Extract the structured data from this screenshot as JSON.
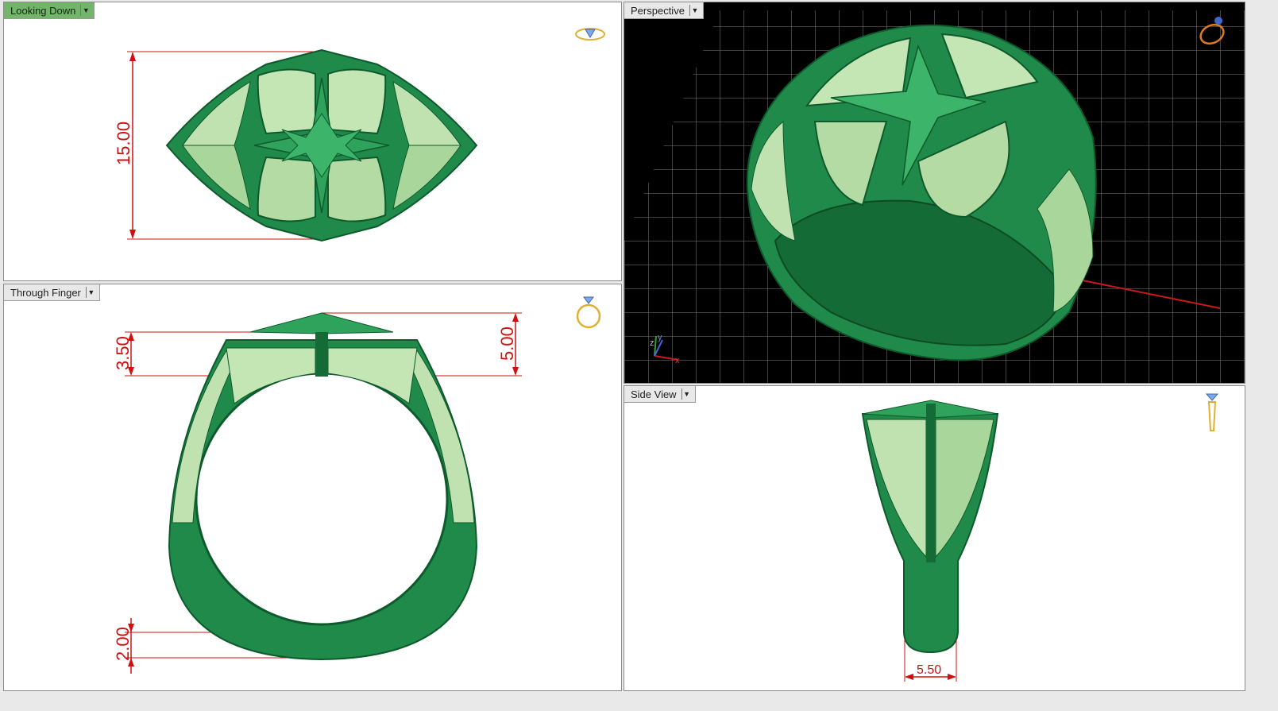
{
  "viewports": {
    "top": {
      "label": "Looking Down",
      "dimension": "15.00"
    },
    "front": {
      "label": "Through Finger",
      "dimension_left": "3.50",
      "dimension_right": "5.00",
      "dimension_bottom": "2.00"
    },
    "perspective": {
      "label": "Perspective",
      "axis_y": "y",
      "axis_z": "z",
      "axis_x": "x"
    },
    "side": {
      "label": "Side View",
      "dimension": "5.50"
    }
  },
  "colors": {
    "ring_green": "#1f8a4a",
    "ring_dark": "#0d5a2c",
    "filigree": "#bfe2b0",
    "dimension_red": "#d01010",
    "active_tab": "#73b56b",
    "grid": "#8c8c8c"
  },
  "icons": {
    "dropdown": "dropdown-arrow-icon",
    "view_gizmo": "ring-gem-view-icon"
  }
}
